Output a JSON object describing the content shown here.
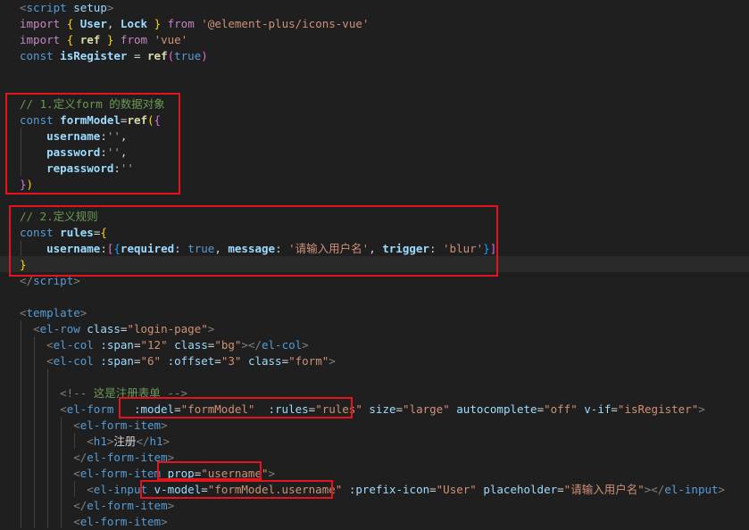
{
  "editor": {
    "lines": [
      [
        [
          "ang",
          "<"
        ],
        [
          "tag",
          "script"
        ],
        [
          "text",
          " "
        ],
        [
          "attr",
          "setup"
        ],
        [
          "ang",
          ">"
        ]
      ],
      [
        [
          "kw2",
          "import"
        ],
        [
          "text",
          " "
        ],
        [
          "brace",
          "{"
        ],
        [
          "text",
          " "
        ],
        [
          "var",
          "User"
        ],
        [
          "text",
          ", "
        ],
        [
          "var",
          "Lock"
        ],
        [
          "text",
          " "
        ],
        [
          "brace",
          "}"
        ],
        [
          "text",
          " "
        ],
        [
          "kw2",
          "from"
        ],
        [
          "text",
          " "
        ],
        [
          "str",
          "'@element-plus/icons-vue'"
        ]
      ],
      [
        [
          "kw2",
          "import"
        ],
        [
          "text",
          " "
        ],
        [
          "brace",
          "{"
        ],
        [
          "text",
          " "
        ],
        [
          "fn",
          "ref"
        ],
        [
          "text",
          " "
        ],
        [
          "brace",
          "}"
        ],
        [
          "text",
          " "
        ],
        [
          "kw2",
          "from"
        ],
        [
          "text",
          " "
        ],
        [
          "str",
          "'vue'"
        ]
      ],
      [
        [
          "kw",
          "const"
        ],
        [
          "text",
          " "
        ],
        [
          "var",
          "isRegister"
        ],
        [
          "text",
          " = "
        ],
        [
          "fn",
          "ref"
        ],
        [
          "brace2",
          "("
        ],
        [
          "bool",
          "true"
        ],
        [
          "brace2",
          ")"
        ]
      ],
      [],
      [],
      [
        [
          "cmt",
          "// 1.定义form 的数据对象"
        ]
      ],
      [
        [
          "kw",
          "const"
        ],
        [
          "text",
          " "
        ],
        [
          "var",
          "formModel"
        ],
        [
          "text",
          "="
        ],
        [
          "fn",
          "ref"
        ],
        [
          "brace",
          "("
        ],
        [
          "brace2",
          "{"
        ]
      ],
      [
        [
          "text",
          "    "
        ],
        [
          "var",
          "username"
        ],
        [
          "text",
          ":"
        ],
        [
          "str",
          "''"
        ],
        [
          "text",
          ","
        ]
      ],
      [
        [
          "text",
          "    "
        ],
        [
          "var",
          "password"
        ],
        [
          "text",
          ":"
        ],
        [
          "str",
          "''"
        ],
        [
          "text",
          ","
        ]
      ],
      [
        [
          "text",
          "    "
        ],
        [
          "var",
          "repassword"
        ],
        [
          "text",
          ":"
        ],
        [
          "str",
          "''"
        ]
      ],
      [
        [
          "brace2",
          "}"
        ],
        [
          "brace",
          ")"
        ]
      ],
      [],
      [
        [
          "cmt",
          "// 2.定义规则"
        ]
      ],
      [
        [
          "kw",
          "const"
        ],
        [
          "text",
          " "
        ],
        [
          "var",
          "rules"
        ],
        [
          "text",
          "="
        ],
        [
          "brace",
          "{"
        ]
      ],
      [
        [
          "text",
          "    "
        ],
        [
          "var",
          "username"
        ],
        [
          "text",
          ":"
        ],
        [
          "brace2",
          "["
        ],
        [
          "brace3",
          "{"
        ],
        [
          "var",
          "required"
        ],
        [
          "text",
          ": "
        ],
        [
          "bool",
          "true"
        ],
        [
          "text",
          ", "
        ],
        [
          "var",
          "message"
        ],
        [
          "text",
          ": "
        ],
        [
          "str",
          "'请输入用户名'"
        ],
        [
          "text",
          ", "
        ],
        [
          "var",
          "trigger"
        ],
        [
          "text",
          ": "
        ],
        [
          "str",
          "'blur'"
        ],
        [
          "brace3",
          "}"
        ],
        [
          "brace2",
          "]"
        ]
      ],
      [
        [
          "brace",
          "}"
        ]
      ],
      [
        [
          "ang",
          "</"
        ],
        [
          "tag",
          "script"
        ],
        [
          "ang",
          ">"
        ]
      ],
      [],
      [
        [
          "ang",
          "<"
        ],
        [
          "tag",
          "template"
        ],
        [
          "ang",
          ">"
        ]
      ],
      [
        [
          "text",
          "  "
        ],
        [
          "ang",
          "<"
        ],
        [
          "tag",
          "el-row"
        ],
        [
          "text",
          " "
        ],
        [
          "attr",
          "class"
        ],
        [
          "text",
          "="
        ],
        [
          "str",
          "\"login-page\""
        ],
        [
          "ang",
          ">"
        ]
      ],
      [
        [
          "text",
          "    "
        ],
        [
          "ang",
          "<"
        ],
        [
          "tag",
          "el-col"
        ],
        [
          "text",
          " "
        ],
        [
          "attr",
          ":span"
        ],
        [
          "text",
          "="
        ],
        [
          "str",
          "\"12\""
        ],
        [
          "text",
          " "
        ],
        [
          "attr",
          "class"
        ],
        [
          "text",
          "="
        ],
        [
          "str",
          "\"bg\""
        ],
        [
          "ang",
          "></"
        ],
        [
          "tag",
          "el-col"
        ],
        [
          "ang",
          ">"
        ]
      ],
      [
        [
          "text",
          "    "
        ],
        [
          "ang",
          "<"
        ],
        [
          "tag",
          "el-col"
        ],
        [
          "text",
          " "
        ],
        [
          "attr",
          ":span"
        ],
        [
          "text",
          "="
        ],
        [
          "str",
          "\"6\""
        ],
        [
          "text",
          " "
        ],
        [
          "attr",
          ":offset"
        ],
        [
          "text",
          "="
        ],
        [
          "str",
          "\"3\""
        ],
        [
          "text",
          " "
        ],
        [
          "attr",
          "class"
        ],
        [
          "text",
          "="
        ],
        [
          "str",
          "\"form\""
        ],
        [
          "ang",
          ">"
        ]
      ],
      [],
      [
        [
          "text",
          "      "
        ],
        [
          "ang",
          "<!-- "
        ],
        [
          "cmt",
          "这是注册表单"
        ],
        [
          "ang",
          " -->"
        ]
      ],
      [
        [
          "text",
          "      "
        ],
        [
          "ang",
          "<"
        ],
        [
          "tag",
          "el-form"
        ],
        [
          "text",
          "   "
        ],
        [
          "attr",
          ":model"
        ],
        [
          "text",
          "="
        ],
        [
          "str",
          "\"formModel\""
        ],
        [
          "text",
          "  "
        ],
        [
          "attr",
          ":rules"
        ],
        [
          "text",
          "="
        ],
        [
          "str",
          "\"rules\""
        ],
        [
          "text",
          " "
        ],
        [
          "attr",
          "size"
        ],
        [
          "text",
          "="
        ],
        [
          "str",
          "\"large\""
        ],
        [
          "text",
          " "
        ],
        [
          "attr",
          "autocomplete"
        ],
        [
          "text",
          "="
        ],
        [
          "str",
          "\"off\""
        ],
        [
          "text",
          " "
        ],
        [
          "attr",
          "v-if"
        ],
        [
          "text",
          "="
        ],
        [
          "str",
          "\"isRegister\""
        ],
        [
          "ang",
          ">"
        ]
      ],
      [
        [
          "text",
          "        "
        ],
        [
          "ang",
          "<"
        ],
        [
          "tag",
          "el-form-item"
        ],
        [
          "ang",
          ">"
        ]
      ],
      [
        [
          "text",
          "          "
        ],
        [
          "ang",
          "<"
        ],
        [
          "tag",
          "h1"
        ],
        [
          "ang",
          ">"
        ],
        [
          "text",
          "注册"
        ],
        [
          "ang",
          "</"
        ],
        [
          "tag",
          "h1"
        ],
        [
          "ang",
          ">"
        ]
      ],
      [
        [
          "text",
          "        "
        ],
        [
          "ang",
          "</"
        ],
        [
          "tag",
          "el-form-item"
        ],
        [
          "ang",
          ">"
        ]
      ],
      [
        [
          "text",
          "        "
        ],
        [
          "ang",
          "<"
        ],
        [
          "tag",
          "el-form-item"
        ],
        [
          "text",
          " "
        ],
        [
          "attr",
          "prop"
        ],
        [
          "text",
          "="
        ],
        [
          "str",
          "\"username\""
        ],
        [
          "ang",
          ">"
        ]
      ],
      [
        [
          "text",
          "          "
        ],
        [
          "ang",
          "<"
        ],
        [
          "tag",
          "el-input"
        ],
        [
          "text",
          " "
        ],
        [
          "attr",
          "v-model"
        ],
        [
          "text",
          "="
        ],
        [
          "str",
          "\"formModel.username\""
        ],
        [
          "text",
          " "
        ],
        [
          "attr",
          ":prefix-icon"
        ],
        [
          "text",
          "="
        ],
        [
          "str",
          "\"User\""
        ],
        [
          "text",
          " "
        ],
        [
          "attr",
          "placeholder"
        ],
        [
          "text",
          "="
        ],
        [
          "str",
          "\"请输入用户名\""
        ],
        [
          "ang",
          "></"
        ],
        [
          "tag",
          "el-input"
        ],
        [
          "ang",
          ">"
        ]
      ],
      [
        [
          "text",
          "        "
        ],
        [
          "ang",
          "</"
        ],
        [
          "tag",
          "el-form-item"
        ],
        [
          "ang",
          ">"
        ]
      ],
      [
        [
          "text",
          "        "
        ],
        [
          "ang",
          "<"
        ],
        [
          "tag",
          "el-form-item"
        ],
        [
          "ang",
          ">"
        ]
      ]
    ]
  },
  "colors": {
    "background": "#1f1f1f",
    "highlight_box": "#e4141f"
  }
}
